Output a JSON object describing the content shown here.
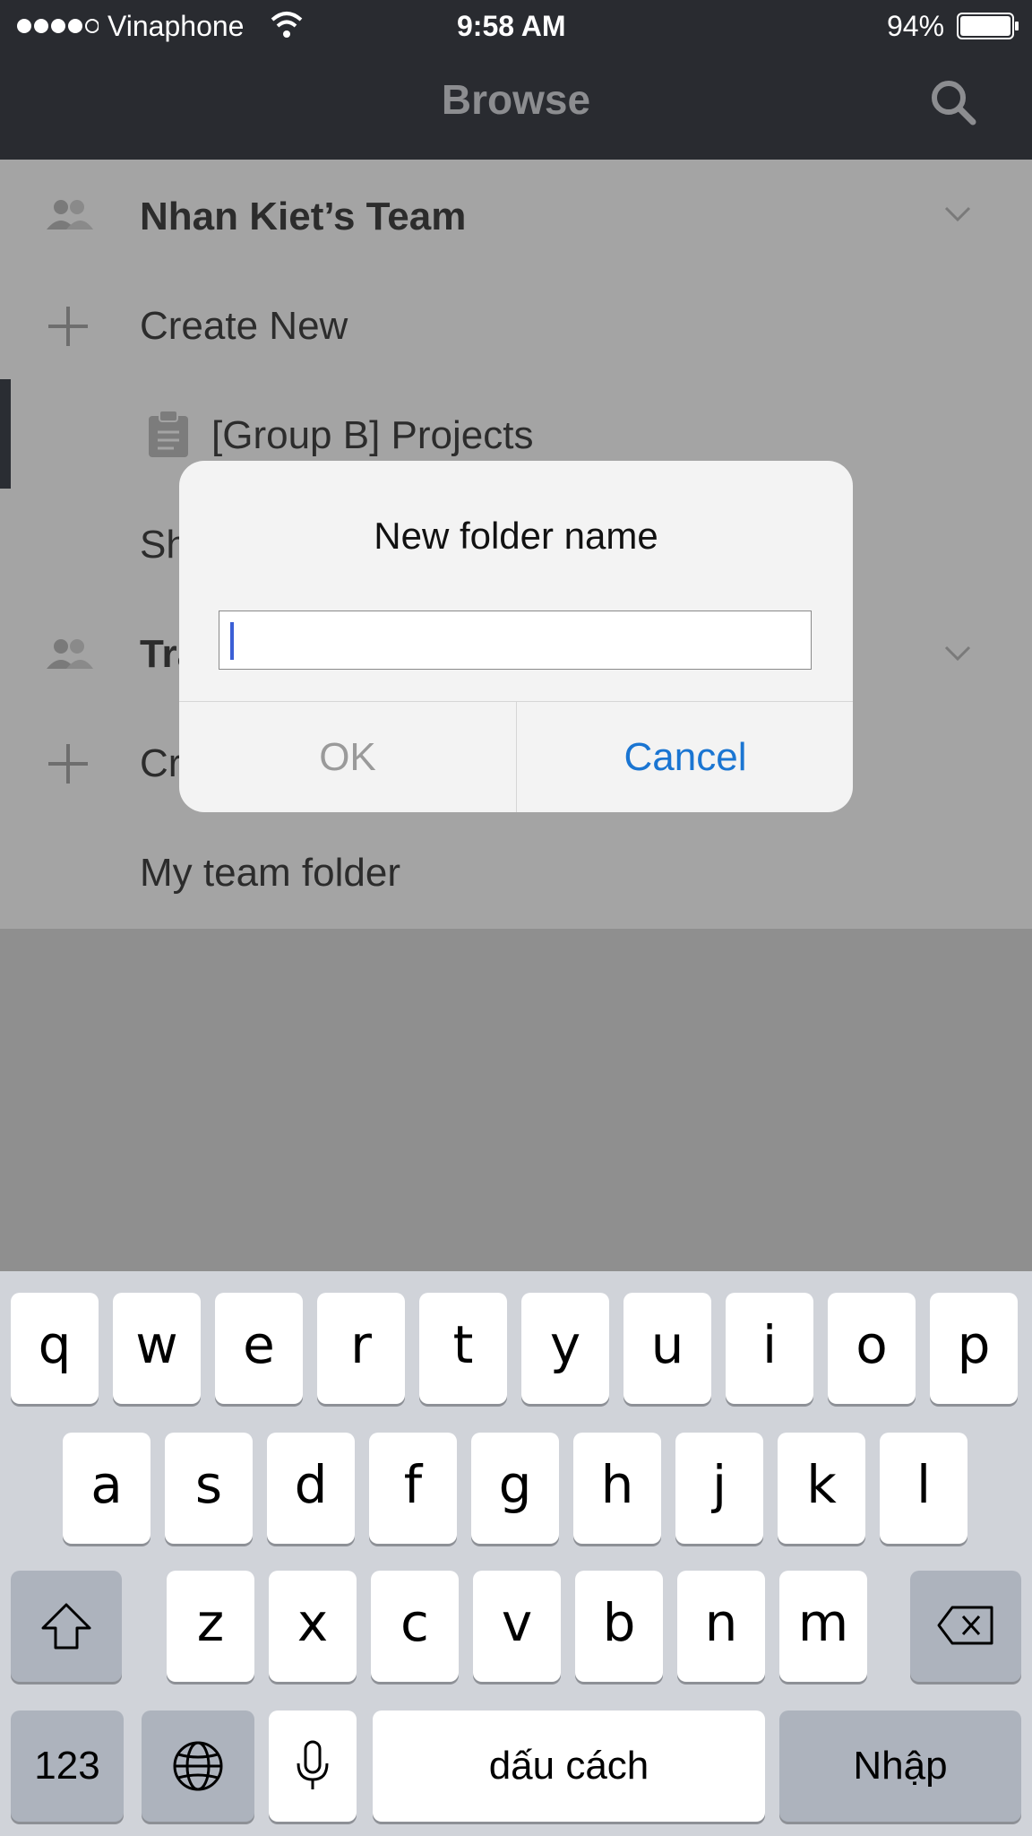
{
  "status_bar": {
    "carrier": "Vinaphone",
    "time": "9:58 AM",
    "battery": "94%",
    "signal_icon": "signal-dots-icon",
    "wifi_icon": "wifi-icon",
    "battery_icon": "battery-icon"
  },
  "nav": {
    "title": "Browse",
    "search_icon": "search-icon"
  },
  "list": {
    "team1_name": "Nhan Kiet’s Team",
    "team1_create": "Create New",
    "team1_project": "[Group B] Projects",
    "team1_shared": "Sh",
    "team2_name": "Tra",
    "team2_create": "Cr",
    "team2_folder": "My team folder"
  },
  "alert": {
    "title": "New folder name",
    "input_value": "",
    "ok_label": "OK",
    "cancel_label": "Cancel",
    "cancel_color": "#1a75d2"
  },
  "keyboard": {
    "row1": [
      "q",
      "w",
      "e",
      "r",
      "t",
      "y",
      "u",
      "i",
      "o",
      "p"
    ],
    "row2": [
      "a",
      "s",
      "d",
      "f",
      "g",
      "h",
      "j",
      "k",
      "l"
    ],
    "row3": [
      "z",
      "x",
      "c",
      "v",
      "b",
      "n",
      "m"
    ],
    "numbers_label": "123",
    "space_label": "dấu cách",
    "return_label": "Nhập",
    "icons": [
      "shift-icon",
      "backspace-icon",
      "globe-icon",
      "microphone-icon"
    ]
  }
}
